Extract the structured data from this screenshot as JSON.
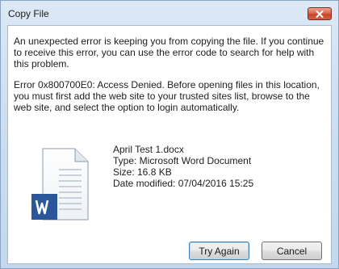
{
  "window": {
    "title": "Copy File",
    "close_icon": "close-icon",
    "close_color": "#c7472b"
  },
  "message": {
    "intro": "An unexpected error is keeping you from copying the file. If you continue to receive this error, you can use the error code to search for help with this problem.",
    "error": "Error 0x800700E0: Access Denied. Before opening files in this location, you must first add the web site to your trusted sites list, browse to the web site, and select the option to login automatically."
  },
  "file": {
    "icon": "word-document-icon",
    "icon_color": "#2b579a",
    "name": "April Test 1.docx",
    "type": "Type: Microsoft Word Document",
    "size": "Size: 16.8 KB",
    "date_modified": "Date modified: 07/04/2016 15:25"
  },
  "buttons": {
    "try_again": "Try Again",
    "cancel": "Cancel"
  }
}
